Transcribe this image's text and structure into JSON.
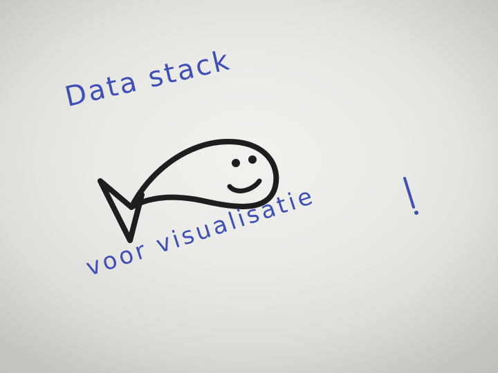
{
  "note": {
    "title": "Data stack",
    "subtitle": "voor visualisatie",
    "exclamation": "!"
  },
  "colors": {
    "paper": "#e9e9e6",
    "ink_blue": "#3f4fb6",
    "ink_black": "#1e1e1e"
  },
  "drawing": {
    "icon": "fish-icon"
  }
}
